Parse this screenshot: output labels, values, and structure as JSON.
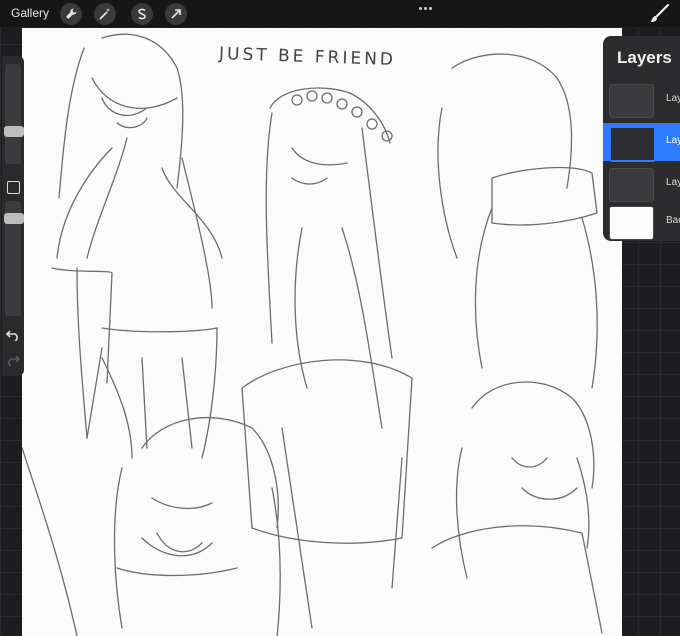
{
  "topbar": {
    "gallery_label": "Gallery",
    "tools": [
      {
        "icon": "wrench-icon"
      },
      {
        "icon": "magic-wand-icon"
      },
      {
        "icon": "selection-s-icon"
      },
      {
        "icon": "transform-arrow-icon"
      }
    ],
    "more_icon": "more-dots-icon",
    "brush_icon": "brush-icon"
  },
  "canvas": {
    "text": "JUST BE FRIEND"
  },
  "layers_panel": {
    "title": "Layers",
    "layers": [
      {
        "name": "Lay",
        "active": false,
        "thumb": "dark"
      },
      {
        "name": "Lay",
        "active": true,
        "thumb": "dark"
      },
      {
        "name": "Lay",
        "active": false,
        "thumb": "dark"
      },
      {
        "name": "Bac",
        "active": false,
        "thumb": "white"
      }
    ]
  },
  "colors": {
    "accent": "#2f7bff",
    "panel": "#2c2c2e",
    "canvas": "#fbfbfb"
  }
}
